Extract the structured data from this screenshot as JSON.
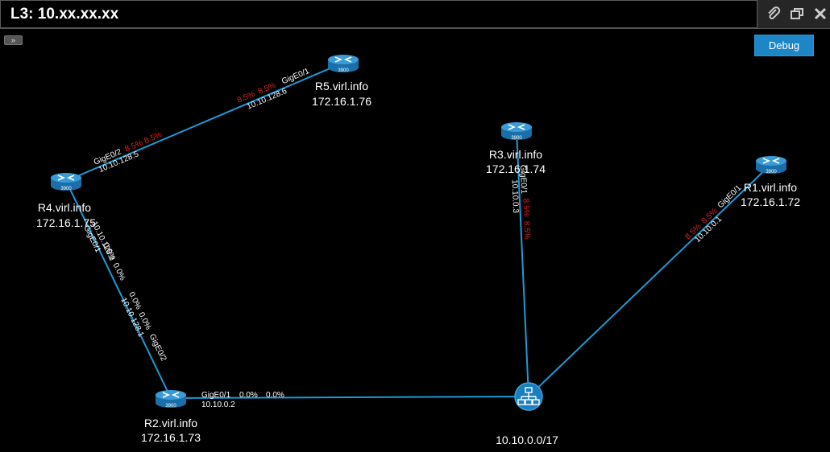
{
  "window": {
    "title": "L3: 10.xx.xx.xx",
    "expand_glyph": "»",
    "debug_label": "Debug",
    "icons": [
      "paperclip-icon",
      "restore-window-icon",
      "close-icon"
    ]
  },
  "colors": {
    "link": "#1e9ad6",
    "router": "#2b86c5",
    "util_high": "#e02020",
    "util_zero": "#ffffff"
  },
  "nodes": [
    {
      "id": "r5",
      "name": "R5.virl.info",
      "ip": "172.16.1.76",
      "model": "3900"
    },
    {
      "id": "r4",
      "name": "R4.virl.info",
      "ip": "172.16.1.75",
      "model": "3900"
    },
    {
      "id": "r3",
      "name": "R3.virl.info",
      "ip": "172.16.1.74",
      "model": "3900"
    },
    {
      "id": "r1",
      "name": "R1.virl.info",
      "ip": "172.16.1.72",
      "model": "3900"
    },
    {
      "id": "r2",
      "name": "R2.virl.info",
      "ip": "172.16.1.73",
      "model": "3900"
    },
    {
      "id": "sw",
      "name": "10.10.0.0/17"
    }
  ],
  "links": [
    {
      "id": "r4-r5",
      "r4_if": "GigE0/2",
      "r4_addr": "10.10.128.5",
      "r4_in": "8.5%",
      "r4_out": "8.5%",
      "r5_if": "GigE0/1",
      "r5_addr": "10.10.128.6",
      "r5_in": "8.5%",
      "r5_out": "8.5%"
    },
    {
      "id": "r4-r2",
      "r4_if": "GigE0/1",
      "r4_addr": "10.10.128.2",
      "r4_in": "0.0%",
      "r4_out": "0.0%",
      "r2_if": "GigE0/2",
      "r2_addr": "10.10.128.1",
      "r2_in": "0.0%",
      "r2_out": "0.0%"
    },
    {
      "id": "r2-sw",
      "r2_if": "GigE0/1",
      "r2_addr": "10.10.0.2",
      "r2_in": "0.0%",
      "r2_out": "0.0%"
    },
    {
      "id": "r3-sw",
      "r3_if": "GigE0/1",
      "r3_addr": "10.10.0.3",
      "r3_in": "8.5%",
      "r3_out": "8.5%"
    },
    {
      "id": "r1-sw",
      "r1_if": "GigE0/1",
      "r1_addr": "10.10.0.1",
      "r1_in": "8.5%",
      "r1_out": "8.5%"
    }
  ]
}
